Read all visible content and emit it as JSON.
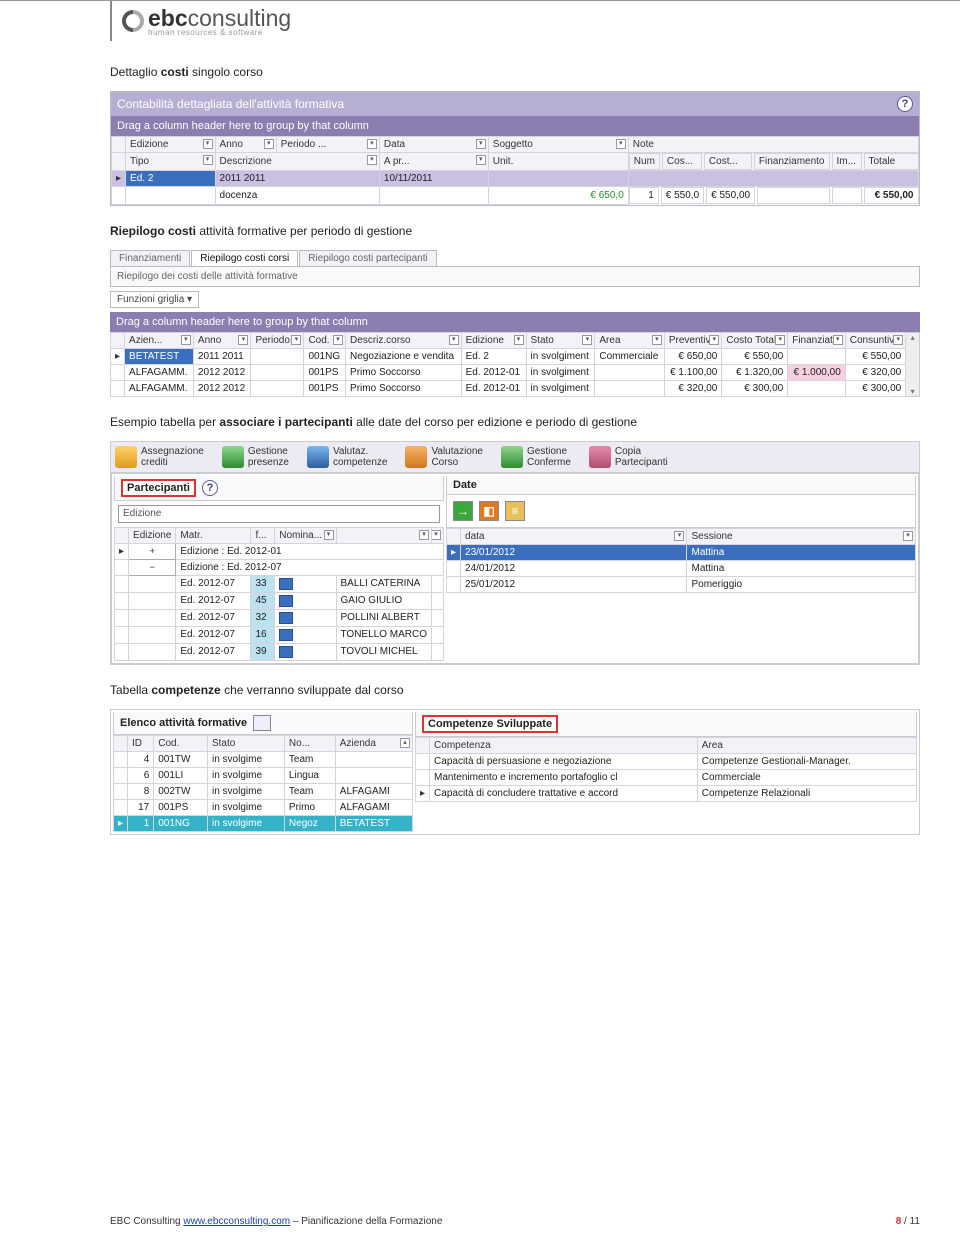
{
  "logo": {
    "brand_bold": "ebc",
    "brand": "consulting",
    "sub": "human resources & software"
  },
  "text": {
    "h1": "Dettaglio ",
    "h1b": "costi",
    "h1c": " singolo corso",
    "h2a": "Riepilogo costi",
    "h2b": " attività formative per periodo di gestione",
    "h3a": "Esempio tabella per ",
    "h3b": "associare i partecipanti",
    "h3c": " alle date del corso per edizione e periodo di gestione",
    "h4a": "Tabella ",
    "h4b": "competenze",
    "h4c": " che verranno sviluppate dal corso"
  },
  "s1": {
    "title": "Contabilità dettagliata dell'attività formativa",
    "groupbar": "Drag a column header here to group by that column",
    "head1": [
      "Edizione",
      "Anno",
      "Periodo ...",
      "Data",
      "Soggetto",
      "Note"
    ],
    "head2": [
      "Tipo",
      "Descrizione",
      "A pr...",
      "Unit.",
      "Num",
      "Cos...",
      "Cost...",
      "Finanziamento",
      "Im...",
      "Totale"
    ],
    "row1": {
      "edizione": "Ed. 2",
      "anno": "2011 2011",
      "data": "10/11/2011"
    },
    "row2": {
      "descr": "docenza",
      "unit": "€ 650,0",
      "num": "1",
      "cos": "€ 550,0",
      "cost": "€ 550,00",
      "totale": "€ 550,00"
    }
  },
  "s2": {
    "tabs": [
      "Finanziamenti",
      "Riepilogo costi corsi",
      "Riepilogo costi partecipanti"
    ],
    "active_tab": 1,
    "subtitle": "Riepilogo dei costi delle attività formative",
    "griglia": "Funzioni griglia ▾",
    "groupbar": "Drag a column header here to group by that column",
    "head": [
      "Azien...",
      "Anno",
      "Periodo...",
      "Cod.",
      "Descriz.corso",
      "Edizione",
      "Stato",
      "Area",
      "Preventivo",
      "Costo Totale",
      "Finanziato",
      "Consuntivo"
    ],
    "rows": [
      {
        "az": "BETATEST",
        "anno": "2011 2011",
        "cod": "001NG",
        "desc": "Negoziazione e vendita",
        "ed": "Ed. 2",
        "stato": "in svolgiment",
        "area": "Commerciale",
        "prev": "€ 650,00",
        "tot": "€ 550,00",
        "fin": "",
        "cons": "€ 550,00",
        "sel": true
      },
      {
        "az": "ALFAGAMM.",
        "anno": "2012 2012",
        "cod": "001PS",
        "desc": "Primo Soccorso",
        "ed": "Ed. 2012-01",
        "stato": "in svolgiment",
        "area": "",
        "prev": "€ 1.100,00",
        "tot": "€ 1.320,00",
        "fin": "€ 1.000,00",
        "cons": "€ 320,00",
        "pink": true
      },
      {
        "az": "ALFAGAMM.",
        "anno": "2012 2012",
        "cod": "001PS",
        "desc": "Primo Soccorso",
        "ed": "Ed. 2012-01",
        "stato": "in svolgiment",
        "area": "",
        "prev": "€ 320,00",
        "tot": "€ 300,00",
        "fin": "",
        "cons": "€ 300,00"
      }
    ]
  },
  "s3": {
    "ribbon": [
      {
        "ic": "ic-yel",
        "t1": "Assegnazione",
        "t2": "crediti"
      },
      {
        "ic": "ic-grn",
        "t1": "Gestione",
        "t2": "presenze"
      },
      {
        "ic": "ic-blu",
        "t1": "Valutaz.",
        "t2": "competenze"
      },
      {
        "ic": "ic-org",
        "t1": "Valutazione",
        "t2": "Corso"
      },
      {
        "ic": "ic-grn",
        "t1": "Gestione",
        "t2": "Conferme"
      },
      {
        "ic": "ic-ppl",
        "t1": "Copia",
        "t2": "Partecipanti"
      }
    ],
    "left": {
      "tab": "Partecipanti",
      "filter_label": "Edizione",
      "head": [
        "Edizione",
        "Matr.",
        "f...",
        "Nomina..."
      ],
      "groups": [
        "Edizione : Ed. 2012-01",
        "Edizione : Ed. 2012-07"
      ],
      "rows": [
        {
          "ed": "Ed. 2012-07",
          "m": "33",
          "n": "BALLI  CATERINA"
        },
        {
          "ed": "Ed. 2012-07",
          "m": "45",
          "n": "GAIO  GIULIO"
        },
        {
          "ed": "Ed. 2012-07",
          "m": "32",
          "n": "POLLINI  ALBERT"
        },
        {
          "ed": "Ed. 2012-07",
          "m": "16",
          "n": "TONELLO  MARCO"
        },
        {
          "ed": "Ed. 2012-07",
          "m": "39",
          "n": "TOVOLI  MICHEL"
        }
      ]
    },
    "right": {
      "tab": "Date",
      "head": [
        "data",
        "Sessione"
      ],
      "rows": [
        {
          "d": "23/01/2012",
          "s": "Mattina",
          "sel": true
        },
        {
          "d": "24/01/2012",
          "s": "Mattina"
        },
        {
          "d": "25/01/2012",
          "s": "Pomeriggio"
        }
      ]
    }
  },
  "s4": {
    "left": {
      "title": "Elenco attività formative",
      "head": [
        "ID",
        "Cod.",
        "Stato",
        "No...",
        "Azienda"
      ],
      "rows": [
        {
          "id": "4",
          "cod": "001TW",
          "st": "in svolgime",
          "no": "Team",
          "az": ""
        },
        {
          "id": "6",
          "cod": "001LI",
          "st": "in svolgime",
          "no": "Lingua",
          "az": ""
        },
        {
          "id": "8",
          "cod": "002TW",
          "st": "in svolgime",
          "no": "Team",
          "az": "ALFAGAMI"
        },
        {
          "id": "17",
          "cod": "001PS",
          "st": "in svolgime",
          "no": "Primo",
          "az": "ALFAGAMI"
        },
        {
          "id": "1",
          "cod": "001NG",
          "st": "in svolgime",
          "no": "Negoz",
          "az": "BETATEST",
          "sel": true
        }
      ]
    },
    "right": {
      "title": "Competenze Sviluppate",
      "head": [
        "Competenza",
        "Area"
      ],
      "rows": [
        {
          "c": "Capacità di persuasione e negoziazione",
          "a": "Competenze Gestionali-Manager."
        },
        {
          "c": "Mantenimento e incremento portafoglio cl",
          "a": "Commerciale"
        },
        {
          "c": "Capacità di concludere trattative e accord",
          "a": "Competenze Relazionali",
          "mk": true
        }
      ]
    }
  },
  "footer": {
    "company": "EBC Consulting ",
    "url": "www.ebcconsulting.com",
    "tail": " – Pianificazione della Formazione",
    "page": "8",
    "sep": " / ",
    "total": "11"
  }
}
